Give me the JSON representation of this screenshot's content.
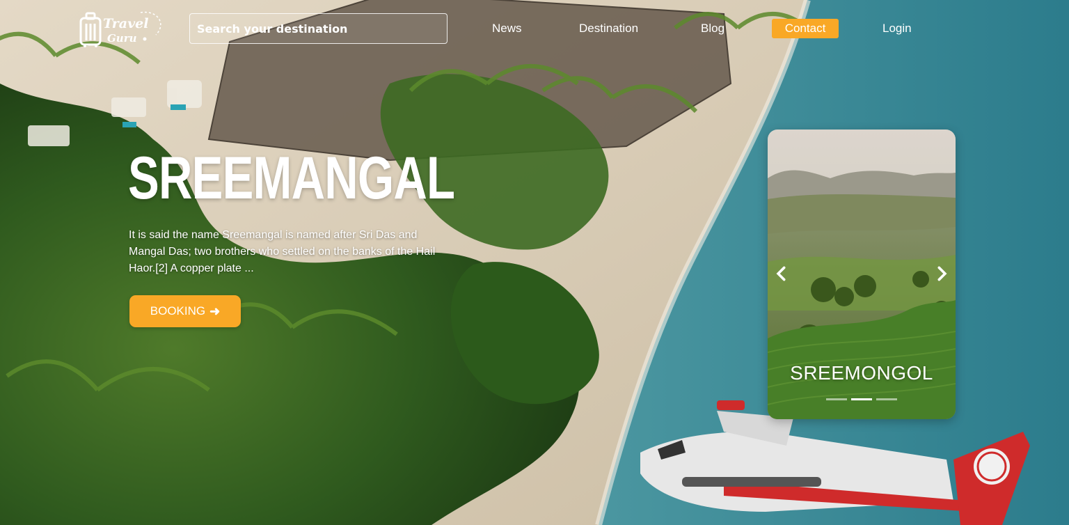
{
  "header": {
    "logo": {
      "line1": "Travel",
      "line2": "Guru"
    },
    "search": {
      "placeholder": "Search your destination",
      "value": ""
    },
    "nav": [
      {
        "label": "News"
      },
      {
        "label": "Destination"
      },
      {
        "label": "Blog"
      },
      {
        "label": "Contact",
        "highlighted": true
      },
      {
        "label": "Login"
      }
    ]
  },
  "hero": {
    "title": "SREEMANGAL",
    "description": "It is said the name Sreemangal is named after Sri Das and Mangal Das; two brothers who settled on the banks of the Hail Haor.[2] A copper plate ...",
    "booking_label": "BOOKING",
    "booking_icon": "arrow-right-icon"
  },
  "carousel": {
    "card_title": "SREEMONGOL",
    "prev_icon": "chevron-left-icon",
    "next_icon": "chevron-right-icon",
    "slides_count": 3,
    "active_index": 1
  },
  "colors": {
    "accent": "#f9a826",
    "text": "#ffffff"
  }
}
